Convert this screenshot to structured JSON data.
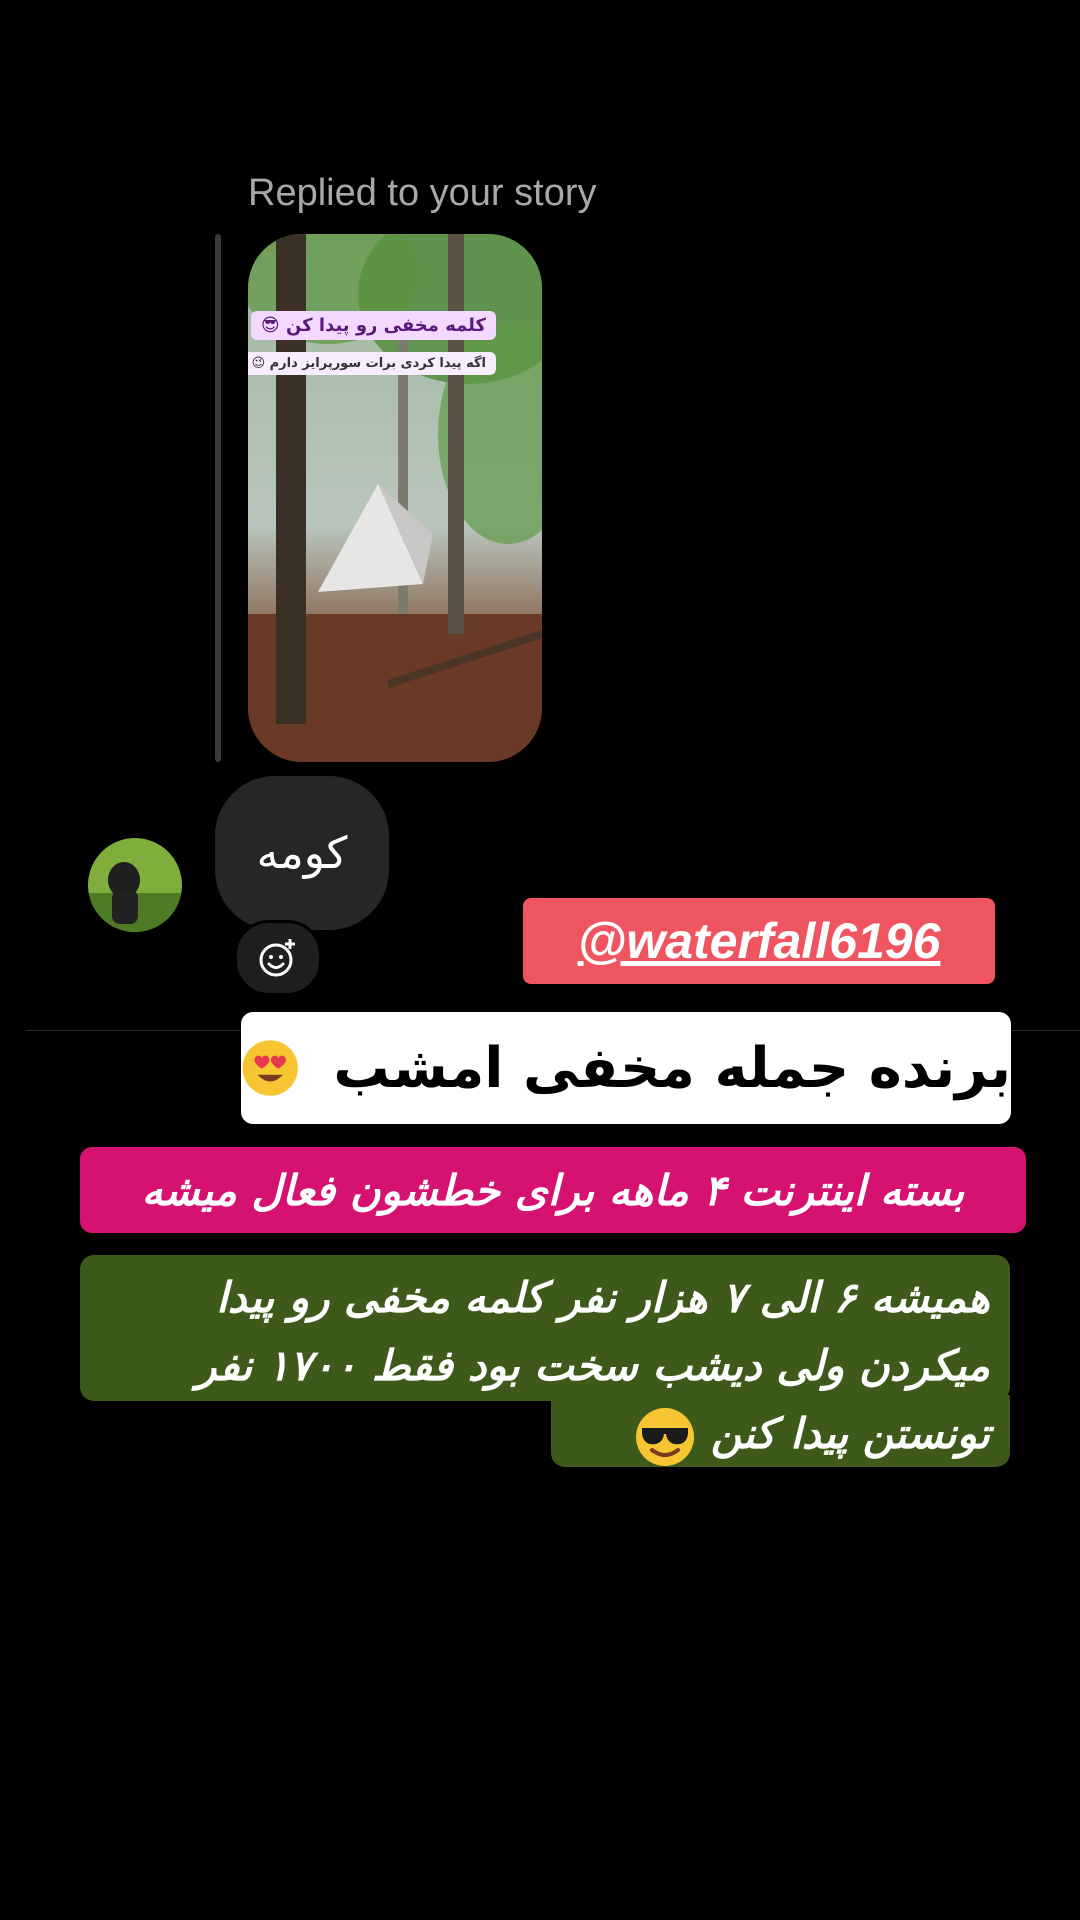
{
  "story_reply": {
    "replied_label": "Replied to your story",
    "thumbnail_caption_1": "کلمه مخفی رو پیدا کن 😎",
    "thumbnail_caption_2": "اگه پیدا کردی برات سورپرایز دارم 😉"
  },
  "message": {
    "text": "کومه",
    "reaction_icon": "add-reaction-icon"
  },
  "overlay": {
    "mention": "@waterfall6196",
    "winner": "برنده جمله مخفی امشب",
    "package": "بسته اینترنت ۴ ماهه برای خطشون فعال میشه",
    "usual_line_1": "همیشه ۶ الی ۷ هزار نفر کلمه مخفی رو پیدا",
    "usual_line_2": "میکردن ولی دیشب سخت بود فقط ۱۷۰۰ نفر",
    "usual_line_3": "تونستن پیدا کنن"
  },
  "colors": {
    "background": "#000000",
    "bubble": "#262626",
    "mention_bg": "#ef5560",
    "package_bg": "#d5126f",
    "usual_bg": "#3e5a1a"
  }
}
